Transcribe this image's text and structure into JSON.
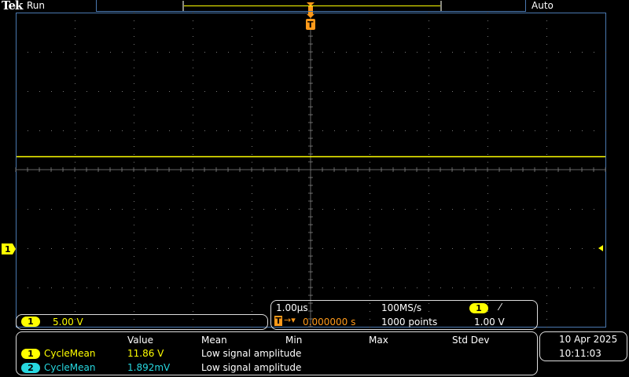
{
  "header": {
    "brand": "Tek",
    "status": "Run",
    "trigger_mode": "Auto"
  },
  "colors": {
    "ch1": "#ffff00",
    "ch2": "#27d8e0",
    "trigger": "#ff9a1a",
    "graticule_border": "#4a78b0"
  },
  "trace": {
    "ch1_level_div": 2.35
  },
  "channel_box": {
    "channel": "1",
    "scale": "5.00 V"
  },
  "timebase": {
    "scale": "1.00µs",
    "sample_rate": "100MS/s",
    "trigger_channel": "1",
    "trigger_slope_icon": "rising-edge-icon",
    "trigger_position": "0.000000 s",
    "record_length": "1000 points",
    "trigger_level": "1.00 V"
  },
  "measurements": {
    "headers": [
      "Value",
      "Mean",
      "Min",
      "Max",
      "Std Dev"
    ],
    "rows": [
      {
        "channel": "1",
        "name": "CycleMean",
        "value": "11.86 V",
        "mean": "Low signal amplitude"
      },
      {
        "channel": "2",
        "name": "CycleMean",
        "value": "1.892mV",
        "mean": "Low signal amplitude"
      }
    ]
  },
  "datetime": {
    "date": "10 Apr  2025",
    "time": "10:11:03"
  }
}
